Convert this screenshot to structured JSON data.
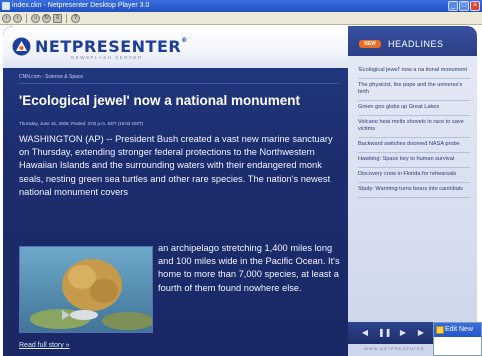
{
  "window": {
    "title": "index.ckn - Netpresenter Desktop Player 3.0",
    "controls": {
      "minimize": "_",
      "maximize": "□",
      "close": "×"
    }
  },
  "toolbar": {
    "buttons": [
      "back",
      "forward",
      "home",
      "refresh",
      "settings",
      "help"
    ]
  },
  "brand": {
    "name": "NETPRESENTER",
    "registered": "®",
    "tagline": "NEWSFLASH SERVER"
  },
  "article": {
    "section": "CNN.com - Science & Space",
    "headline": "'Ecological jewel' now a national monument",
    "dateline": "Thursday, June 15, 2006; Posted: 3:03 p.m. EDT (19:03 GMT)",
    "lead": "WASHINGTON (AP) -- President Bush created a vast new marine sanctuary on Thursday, extending stronger federal protections to the Northwestern Hawaiian Islands and the surrounding waters with their endangered monk seals, nesting green sea turtles and other rare species. The nation's newest national monument covers",
    "rest": "an archipelago stretching 1,400 miles long and 100 miles wide in the Pacific Ocean. It's home to more than 7,000 species, at least a fourth of them found nowhere else.",
    "read_more": "Read full story »"
  },
  "sidebar": {
    "badge": "NEW",
    "title": "HEADLINES",
    "items": [
      "'Ecological jewel' now a na tional monument",
      "The physicist, the pope and the universe's birth",
      "Green goo globs up Great Lakes",
      "Volcano heat melts shovels in race to save victims",
      "Backward switches doomed NASA probe",
      "Hawking: Space key to human survival",
      "Discovery crew in Florida for rehearsals",
      "Study: Warming turns bears into cannibals"
    ],
    "footer_url": "WWW.NETPRESENTER"
  },
  "player_controls": [
    "previous",
    "pause",
    "play",
    "next"
  ],
  "popup": {
    "title": "Edit New"
  },
  "colors": {
    "accent_blue": "#1d3f9a",
    "panel_dark": "#1c2d6e",
    "badge_orange": "#e96d24"
  }
}
